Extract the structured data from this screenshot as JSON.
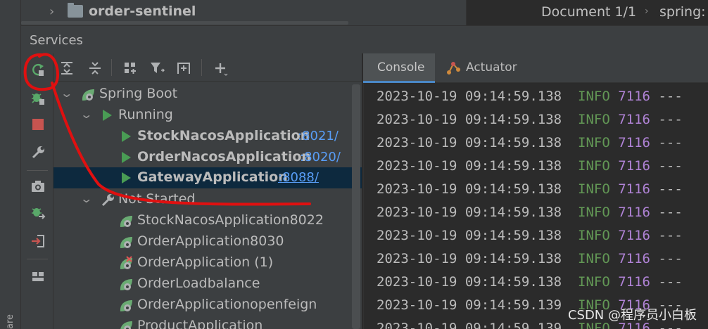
{
  "side_strip_text": "are",
  "project": {
    "name": "order-sentinel"
  },
  "editor": {
    "doc_label": "Document 1/1",
    "crumb": "spring:"
  },
  "services": {
    "title": "Services"
  },
  "tree": {
    "spring_boot": "Spring Boot",
    "running": "Running",
    "running_apps": [
      {
        "name": "StockNacosApplication",
        "port": ":8021/"
      },
      {
        "name": "OrderNacosApplication",
        "port": ":8020/"
      },
      {
        "name": "GatewayApplication",
        "port": ":8088/"
      }
    ],
    "not_started": "Not Started",
    "stopped_apps": [
      "StockNacosApplication8022",
      "OrderApplication8030",
      "OrderApplication (1)",
      "OrderLoadbalance",
      "OrderApplicationopenfeign",
      "ProductApplication"
    ]
  },
  "tabs": {
    "console": "Console",
    "actuator": "Actuator"
  },
  "console_lines": [
    {
      "ts": "2023-10-19 09:14:59.138",
      "level": "INFO",
      "pid": "7116",
      "rest": "---"
    },
    {
      "ts": "2023-10-19 09:14:59.138",
      "level": "INFO",
      "pid": "7116",
      "rest": "---"
    },
    {
      "ts": "2023-10-19 09:14:59.138",
      "level": "INFO",
      "pid": "7116",
      "rest": "---"
    },
    {
      "ts": "2023-10-19 09:14:59.138",
      "level": "INFO",
      "pid": "7116",
      "rest": "---"
    },
    {
      "ts": "2023-10-19 09:14:59.138",
      "level": "INFO",
      "pid": "7116",
      "rest": "---"
    },
    {
      "ts": "2023-10-19 09:14:59.138",
      "level": "INFO",
      "pid": "7116",
      "rest": "---"
    },
    {
      "ts": "2023-10-19 09:14:59.138",
      "level": "INFO",
      "pid": "7116",
      "rest": "---"
    },
    {
      "ts": "2023-10-19 09:14:59.138",
      "level": "INFO",
      "pid": "7116",
      "rest": "---"
    },
    {
      "ts": "2023-10-19 09:14:59.138",
      "level": "INFO",
      "pid": "7116",
      "rest": "---"
    },
    {
      "ts": "2023-10-19 09:14:59.139",
      "level": "INFO",
      "pid": "7116",
      "rest": "---"
    },
    {
      "ts": "2023-10-19 09:14:59.139",
      "level": "INFO",
      "pid": "7116",
      "rest": "---"
    }
  ],
  "watermark": "CSDN @程序员小白板",
  "colors": {
    "green": "#499c54",
    "accent": "#4a88c7",
    "annotation": "#e01010",
    "link": "#589df6"
  }
}
